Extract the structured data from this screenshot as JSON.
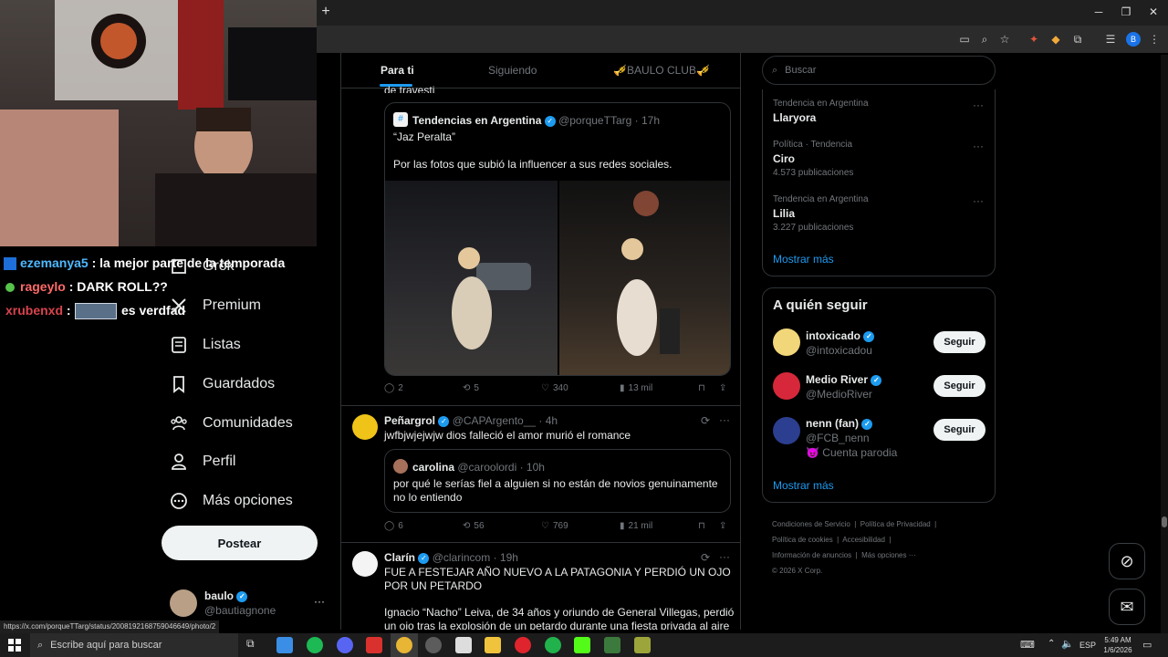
{
  "browser": {
    "new_tab_glyph": "+",
    "profile_initial": "B"
  },
  "chat": [
    {
      "user": "ezemanya5",
      "message": ": la mejor parte de la temporada",
      "color": "#4fb8ff"
    },
    {
      "user": "rageylo",
      "message": ": DARK ROLL??",
      "color": "#ff6a6a"
    },
    {
      "user": "xrubenxd",
      "message": ":",
      "suffix": "es verdfad",
      "color": "#d9434d"
    }
  ],
  "nav": {
    "items": [
      {
        "label": "Grok"
      },
      {
        "label": "Premium"
      },
      {
        "label": "Listas"
      },
      {
        "label": "Guardados"
      },
      {
        "label": "Comunidades"
      },
      {
        "label": "Perfil"
      },
      {
        "label": "Más opciones"
      }
    ],
    "post_button": "Postear",
    "account": {
      "name": "baulo",
      "handle": "@bautiagnone"
    }
  },
  "timeline": {
    "tabs": [
      "Para ti",
      "Siguiendo",
      "🎺BAULO CLUB🎺"
    ],
    "active_tab": "Para ti",
    "clipped_text": "de travesti",
    "tweets": [
      {
        "quote": {
          "name": "Tendencias en Argentina",
          "handle": "@porqueTTarg",
          "time": "· 17h",
          "line1": "“Jaz Peralta”",
          "line2": "Por las fotos que subió la influencer a sus redes sociales."
        },
        "replies": "2",
        "reposts": "5",
        "likes": "340",
        "views": "13 mil"
      },
      {
        "name": "Peñargrol",
        "handle": "@CAPArgento__",
        "time": "· 4h",
        "text": "jwfbjwjejwjw dios falleció el amor murió el romance",
        "quote": {
          "name": "carolina",
          "handle": "@caroolordi",
          "time": "· 10h",
          "text": "por qué le serías fiel a alguien si no están de novios genuinamente no lo entiendo"
        },
        "replies": "6",
        "reposts": "56",
        "likes": "769",
        "views": "21 mil"
      },
      {
        "name": "Clarín",
        "handle": "@clarincom",
        "time": "· 19h",
        "headline": "FUE A FESTEJAR AÑO NUEVO A LA PATAGONIA Y PERDIÓ UN OJO POR UN PETARDO",
        "body": "Ignacio “Nacho” Leiva, de 34 años y oriundo de General Villegas, perdió un ojo tras la explosión de un petardo durante una fiesta privada al aire libre"
      }
    ]
  },
  "right": {
    "search_placeholder": "Buscar",
    "trends": [
      {
        "context": "Tendencia en Argentina",
        "name": "Llaryora",
        "count": ""
      },
      {
        "context": "Política · Tendencia",
        "name": "Ciro",
        "count": "4.573 publicaciones"
      },
      {
        "context": "Tendencia en Argentina",
        "name": "Lilia",
        "count": "3.227 publicaciones"
      }
    ],
    "show_more": "Mostrar más",
    "who_to_follow_title": "A quién seguir",
    "follow_label": "Seguir",
    "suggestions": [
      {
        "name": "intoxicado",
        "handle": "@intoxicadou",
        "note": ""
      },
      {
        "name": "Medio River",
        "handle": "@MedioRiver",
        "note": ""
      },
      {
        "name": "nenn (fan)",
        "handle": "@FCB_nenn",
        "note": "😈 Cuenta parodia"
      }
    ],
    "footer": [
      "Condiciones de Servicio",
      "Política de Privacidad",
      "Política de cookies",
      "Accesibilidad",
      "Información de anuncios",
      "Más opciones ···",
      "© 2026 X Corp."
    ]
  },
  "status_url": "https://x.com/porqueTTarg/status/2008192168759046649/photo/2",
  "taskbar": {
    "search_placeholder": "Escribe aquí para buscar",
    "lang": "ESP",
    "time": "5:49 AM",
    "date": "1/6/2026"
  }
}
